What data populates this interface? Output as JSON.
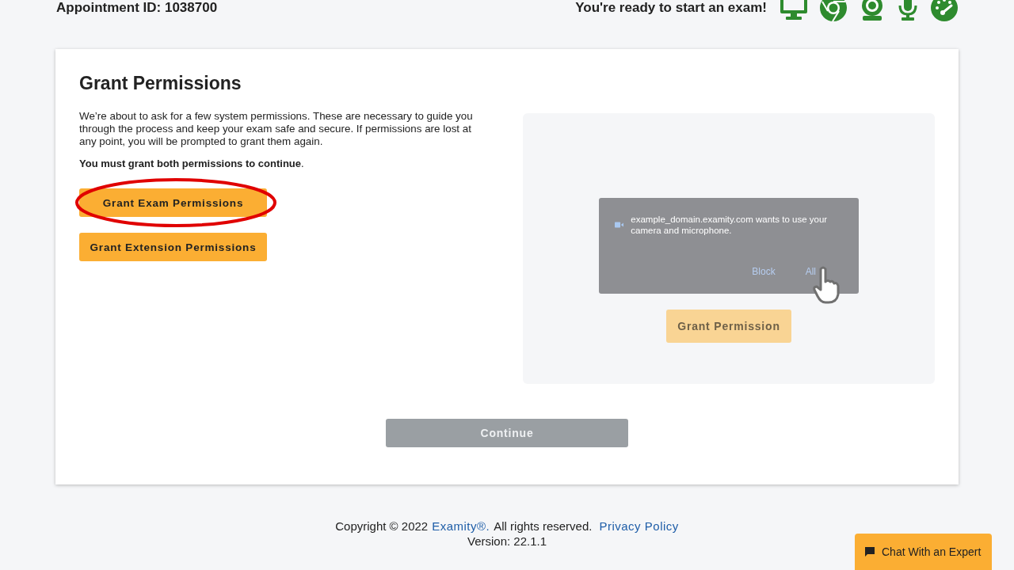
{
  "header": {
    "appointment": "Appointment ID: 1038700",
    "ready_message": "You're ready to start an exam!",
    "checks": [
      {
        "kind": "monitor",
        "passed": true
      },
      {
        "kind": "browser",
        "passed": true
      },
      {
        "kind": "webcam",
        "passed": true
      },
      {
        "kind": "microphone",
        "passed": true
      },
      {
        "kind": "speed",
        "passed": true
      }
    ]
  },
  "card": {
    "title": "Grant Permissions",
    "intro": "We’re about to ask for a few system permissions. These are necessary to guide you through the process and keep your exam safe and secure. If permissions are lost at any point, you will be prompted to grant them again.",
    "requirement": "**You must grant both permissions to continue**.",
    "buttons": [
      {
        "label": "Grant Exam Permissions",
        "highlighted": true
      },
      {
        "label": "Grant Extension Permissions",
        "highlighted": false
      }
    ],
    "preview": {
      "prompt": "example_domain.examity.com wants to use your camera and microphone.",
      "block": "Block",
      "allow": "All",
      "button": "Grant Permission"
    },
    "continue": {
      "label": "Continue",
      "disabled": true
    }
  },
  "footer": {
    "copyright": "Copyright © 2022",
    "brand": "Examity®.",
    "rights": "All rights reserved.",
    "privacy": "Privacy Policy",
    "version": "Version: 22.1.1"
  },
  "chat": {
    "label": "Chat With an Expert"
  }
}
